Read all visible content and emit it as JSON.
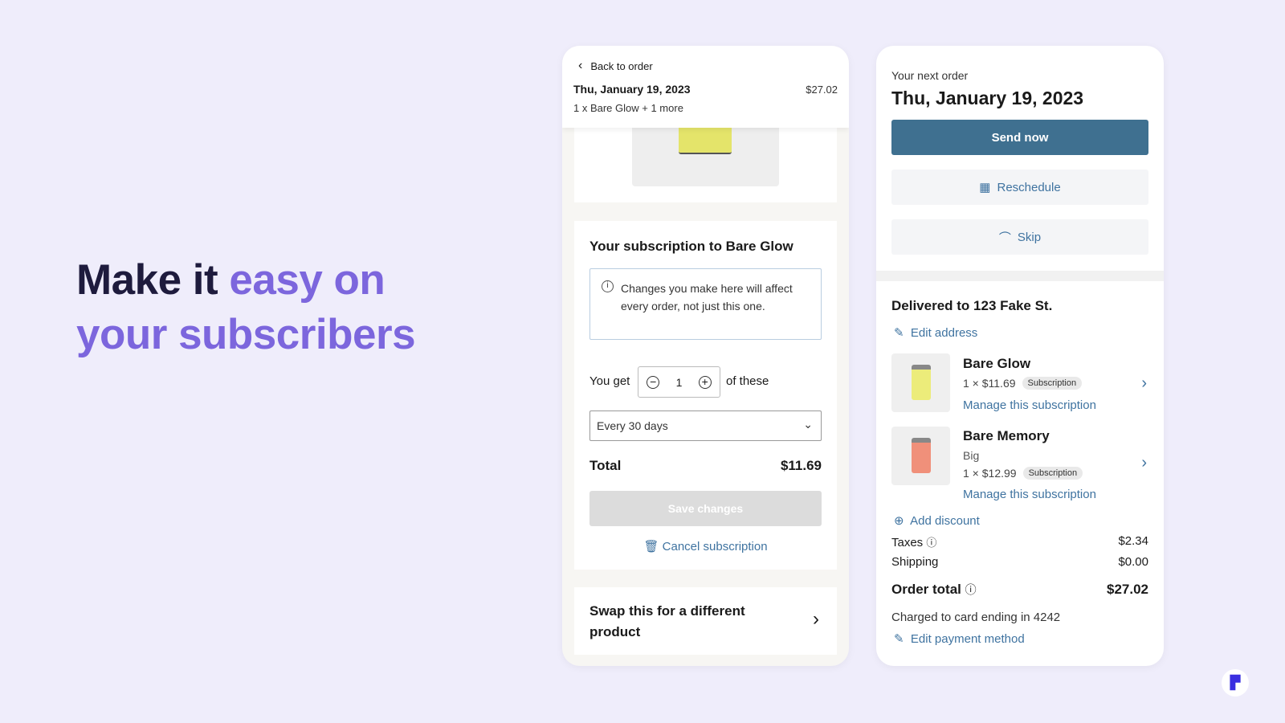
{
  "hero": {
    "line1_dark": "Make it",
    "line1_accent": "easy on",
    "line2_accent": "your subscribers"
  },
  "left": {
    "back": "Back to order",
    "date": "Thu, January 19, 2023",
    "price": "$27.02",
    "summary": "1 x Bare Glow + 1 more",
    "sub_title": "Your subscription to Bare Glow",
    "notice": "Changes you make here will affect every order, not just this one.",
    "you_get": "You get",
    "qty": "1",
    "of_these": "of these",
    "frequency": "Every 30 days",
    "total_label": "Total",
    "total": "$11.69",
    "save": "Save changes",
    "cancel": "Cancel subscription",
    "swap": "Swap this for a different product"
  },
  "right": {
    "next_label": "Your next order",
    "date": "Thu, January 19, 2023",
    "send_now": "Send now",
    "reschedule": "Reschedule",
    "skip": "Skip",
    "delivered": "Delivered to 123 Fake St.",
    "edit_address": "Edit address",
    "items": [
      {
        "name": "Bare Glow",
        "variant": "",
        "price": "1 × $11.69",
        "badge": "Subscription",
        "manage": "Manage this subscription",
        "color": "#ecec7a"
      },
      {
        "name": "Bare Memory",
        "variant": "Big",
        "price": "1 × $12.99",
        "badge": "Subscription",
        "manage": "Manage this subscription",
        "color": "#f0907a"
      }
    ],
    "add_discount": "Add discount",
    "taxes_label": "Taxes",
    "taxes": "$2.34",
    "shipping_label": "Shipping",
    "shipping": "$0.00",
    "order_total_label": "Order total",
    "order_total": "$27.02",
    "charged": "Charged to card ending in 4242",
    "edit_payment": "Edit payment method"
  },
  "colors": {
    "accent": "#7c66dd",
    "primary_button": "#3f7090",
    "link": "#3f73a0"
  }
}
